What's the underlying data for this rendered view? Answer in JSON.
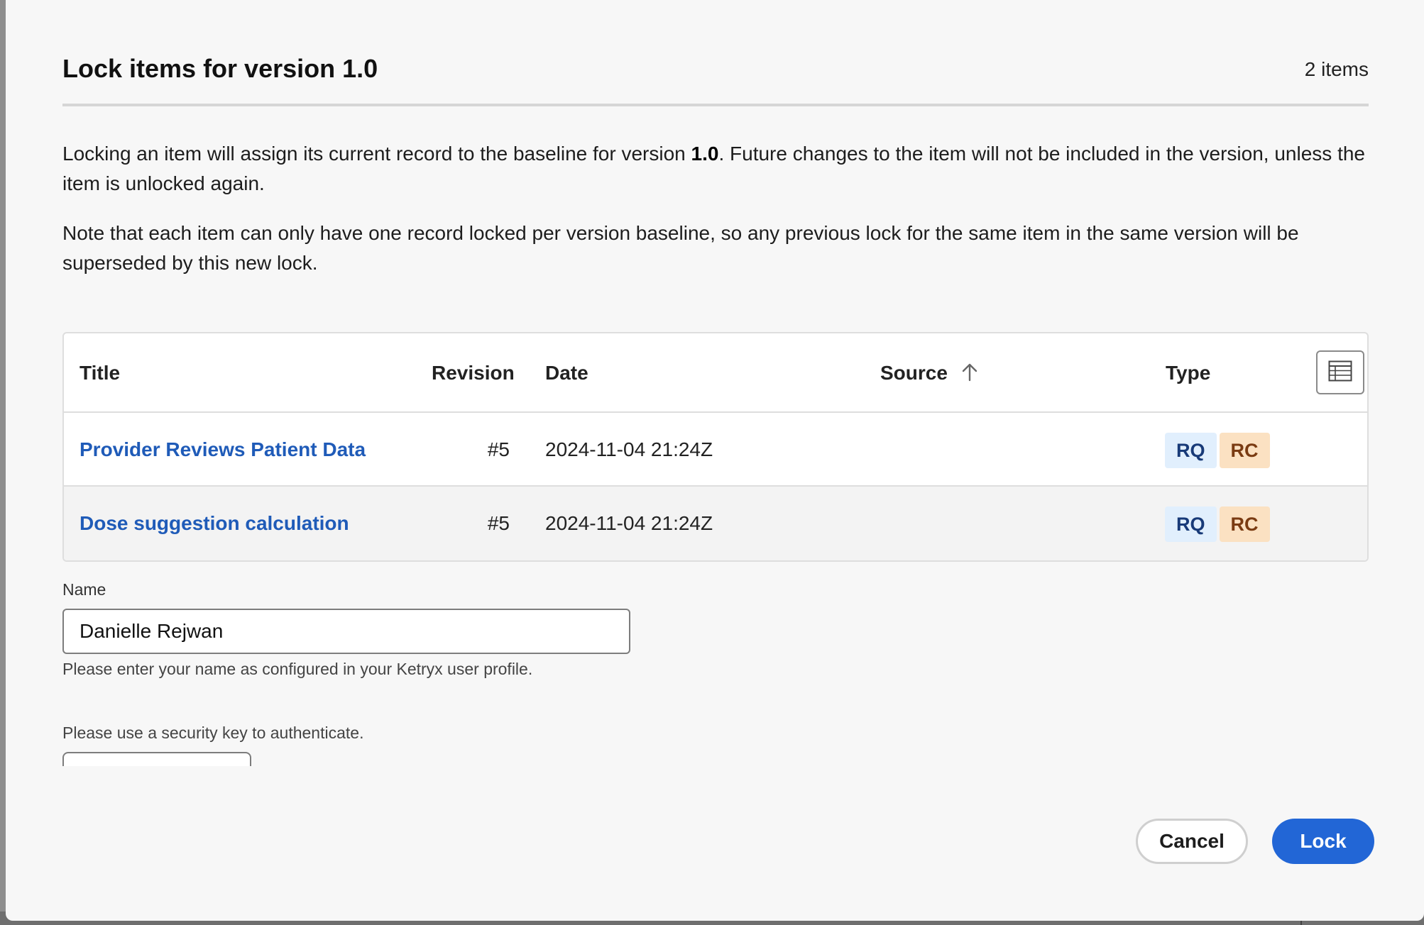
{
  "dialog": {
    "title": "Lock items for version 1.0",
    "item_count": "2 items",
    "description_1_pre": "Locking an item will assign its current record to the baseline for version ",
    "description_1_version": "1.0",
    "description_1_post": ". Future changes to the item will not be included in the version, unless the item is unlocked again.",
    "description_2": "Note that each item can only have one record locked per version baseline, so any previous lock for the same item in the same version will be superseded by this new lock."
  },
  "table": {
    "columns": {
      "title": "Title",
      "revision": "Revision",
      "date": "Date",
      "source": "Source",
      "type": "Type"
    },
    "source_sort_icon": "arrow-up-icon",
    "column_toggle_icon": "table-columns-icon",
    "rows": [
      {
        "title": "Provider Reviews Patient Data",
        "revision": "#5",
        "date": "2024-11-04 21:24Z",
        "source": "",
        "types": [
          "RQ",
          "RC"
        ]
      },
      {
        "title": "Dose suggestion calculation",
        "revision": "#5",
        "date": "2024-11-04 21:24Z",
        "source": "",
        "types": [
          "RQ",
          "RC"
        ]
      }
    ]
  },
  "form": {
    "name_label": "Name",
    "name_value": "Danielle Rejwan",
    "name_help": "Please enter your name as configured in your Ketryx user profile.",
    "security_text": "Please use a security key to authenticate."
  },
  "actions": {
    "cancel_label": "Cancel",
    "lock_label": "Lock"
  },
  "colors": {
    "link": "#1f5bb8",
    "primary_button": "#2266d6",
    "badge_rq_bg": "#e1effd",
    "badge_rc_bg": "#fbe1c2"
  }
}
